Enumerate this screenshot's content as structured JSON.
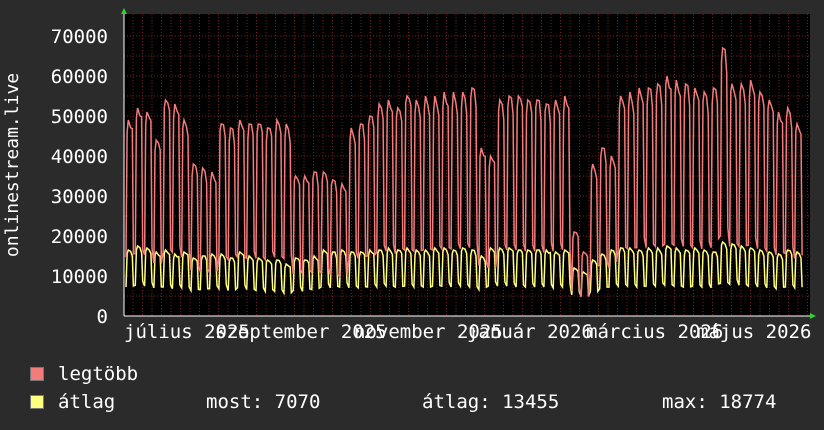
{
  "chart_data": {
    "type": "line",
    "ylabel": "onlinestream.live",
    "ylim": [
      0,
      70000
    ],
    "y_ticks": [
      "0",
      "10000",
      "20000",
      "30000",
      "40000",
      "50000",
      "60000",
      "70000"
    ],
    "x_tick_labels": [
      "július 2025",
      "szeptember 2025",
      "november 2025",
      "január 2026",
      "március 2026",
      "május 2026"
    ],
    "grid": true,
    "colors": {
      "legtobb": "#f27b7b",
      "atlag": "#ffff80",
      "background": "#2b2b2b",
      "plot_bg": "#000000",
      "grid": "#7a1f1f"
    },
    "series": [
      {
        "name": "legtöbb",
        "values": [
          49000,
          52000,
          51000,
          44000,
          54000,
          53000,
          49000,
          38000,
          37000,
          36000,
          48000,
          47000,
          49000,
          48000,
          48000,
          47000,
          49000,
          48000,
          35000,
          35000,
          36000,
          36000,
          34000,
          33000,
          47000,
          48000,
          50000,
          53000,
          54000,
          52000,
          55000,
          54000,
          55000,
          55000,
          56000,
          56000,
          56000,
          57000,
          42000,
          40000,
          54000,
          55000,
          55000,
          54000,
          54000,
          53000,
          54000,
          55000,
          21000,
          16000,
          38000,
          42000,
          40000,
          55000,
          56000,
          57000,
          57000,
          58000,
          60000,
          59000,
          58000,
          57000,
          56000,
          57000,
          67000,
          58000,
          58000,
          59000,
          56000,
          54000,
          51000,
          52000,
          48000
        ]
      },
      {
        "name": "átlag",
        "values": [
          16500,
          17500,
          17000,
          16000,
          16500,
          15500,
          16000,
          14500,
          15000,
          15500,
          15500,
          14500,
          16000,
          15000,
          14500,
          14000,
          14000,
          13000,
          14500,
          14000,
          15000,
          16500,
          16000,
          16500,
          16000,
          16000,
          16500,
          16500,
          17000,
          16500,
          17000,
          16500,
          16500,
          17000,
          17000,
          16500,
          17000,
          16500,
          15000,
          17000,
          17000,
          17000,
          16500,
          16500,
          16500,
          16500,
          16000,
          16500,
          12000,
          11000,
          14000,
          15500,
          16500,
          17000,
          17000,
          16500,
          17000,
          17000,
          17500,
          17000,
          16500,
          17000,
          16500,
          16000,
          18500,
          18000,
          17500,
          17000,
          16500,
          16000,
          15500,
          16500,
          16000
        ],
        "stats": {
          "most_label": "most:",
          "most": "7070",
          "atlag_label": "átlag:",
          "atlag": "13455",
          "max_label": "max:",
          "max": "18774"
        }
      }
    ]
  },
  "legend": {
    "legtobb_label": "legtöbb",
    "atlag_label": "átlag"
  }
}
